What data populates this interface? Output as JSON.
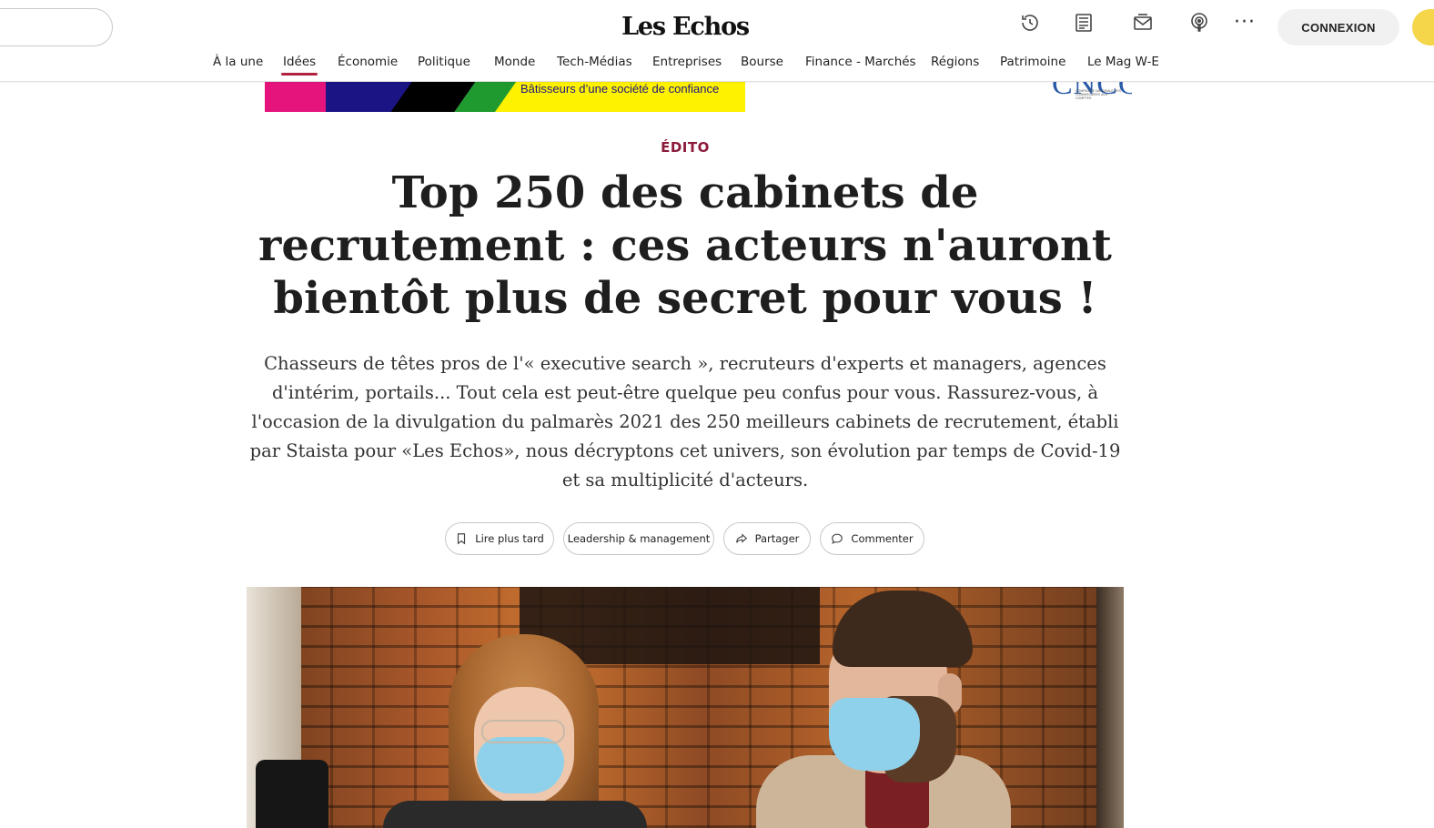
{
  "header": {
    "logo": "Les Echos",
    "connexion_label": "CONNEXION",
    "more_label": "···",
    "icons": [
      "history-icon",
      "newspaper-icon",
      "mail-icon",
      "podcast-icon"
    ]
  },
  "nav": {
    "items": [
      {
        "label": "À la une"
      },
      {
        "label": "Idées",
        "active": true
      },
      {
        "label": "Économie"
      },
      {
        "label": "Politique"
      },
      {
        "label": "Monde"
      },
      {
        "label": "Tech-Médias"
      },
      {
        "label": "Entreprises"
      },
      {
        "label": "Bourse"
      },
      {
        "label": "Finance - Marchés"
      },
      {
        "label": "Régions"
      },
      {
        "label": "Patrimoine"
      },
      {
        "label": "Le Mag W-E"
      }
    ]
  },
  "ad": {
    "text": "Bâtisseurs d’une société de confiance",
    "logo_text": "CNCC",
    "logo_subtext": "Compagnie nationale des commissaires aux comptes"
  },
  "article": {
    "kicker": "ÉDITO",
    "title": "Top 250 des cabinets de recrutement : ces acteurs n'auront bientôt plus de secret pour vous !",
    "lead": "Chasseurs de têtes pros de l'« executive search », recruteurs d'experts et managers, agences d'intérim, portails... Tout cela est peut-être quelque peu confus pour vous. Rassurez-vous, à l'occasion de la divulgation du palmarès 2021 des 250 meilleurs cabinets de recrutement, établi par Staista pour «Les Echos», nous décryptons cet univers, son évolution par temps de Covid-19 et sa multiplicité d'acteurs.",
    "actions": {
      "read_later": "Lire plus tard",
      "topic": "Leadership & management",
      "share": "Partager",
      "comment": "Commenter"
    }
  },
  "colors": {
    "accent": "#b1213f",
    "kicker": "#8c1a3a",
    "connexion_bg": "#f1f1f1",
    "avatar": "#f5d64a"
  }
}
